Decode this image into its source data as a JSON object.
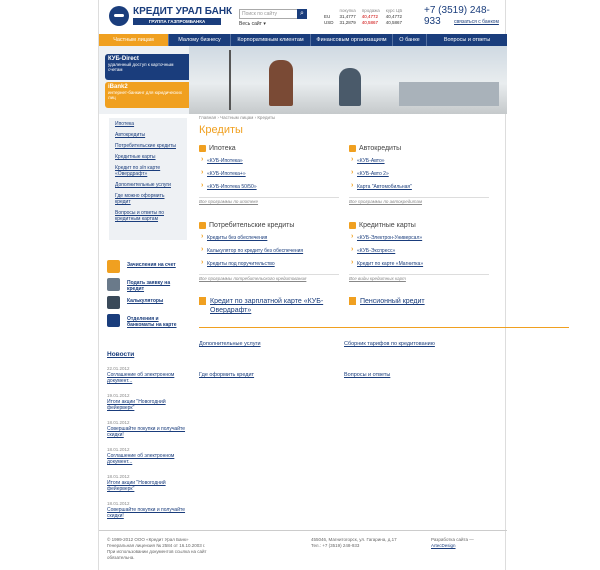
{
  "header": {
    "logo_name": "КРЕДИТ УРАЛ БАНК",
    "logo_sub": "ГРУППА ГАЗПРОМБАНКА",
    "search_placeholder": "Поиск по сайту",
    "all_site": "Весь сайт ▾",
    "rates": {
      "h1": "покупка",
      "h2": "продажа",
      "h3": "курс ЦБ",
      "eur": {
        "name": "EU",
        "buy": "31,4777",
        "sell": "40,4772",
        "cb": "40,4772"
      },
      "usd": {
        "name": "USD",
        "buy": "31,2879",
        "sell": "40,5867",
        "cb": "40,5867"
      }
    },
    "phone": "+7 (3519) 248-933",
    "contact": "связаться с банком"
  },
  "nav": [
    "Частным лицам",
    "Малому бизнесу",
    "Корпоративным клиентам",
    "Финансовым организациям",
    "О банке",
    "Вопросы и ответы"
  ],
  "banner": {
    "kub_title": "КУБ-Direct",
    "kub_text": "удаленный доступ к карточным счетам",
    "ibank_title": "iBank2",
    "ibank_text": "интернет-банкинг для юридических лиц"
  },
  "left_menu": [
    "Ипотека",
    "Автокредиты",
    "Потребительские кредиты",
    "Кредитные карты",
    "Кредит по з/п карте «Овердрафт»",
    "Дополнительные услуги",
    "Где можно оформить кредит",
    "Вопросы и ответы по кредитным картам"
  ],
  "services": [
    {
      "label": "Зачисления на счет",
      "color": "#f0a020"
    },
    {
      "label": "Подать заявку на кредит",
      "color": "#6a7a8a"
    },
    {
      "label": "Калькуляторы",
      "color": "#3a4a5a"
    },
    {
      "label": "Отделения и банкоматы на карте",
      "color": "#1a3d7c"
    }
  ],
  "news_title": "Новости",
  "news": [
    {
      "date": "22.01.2012",
      "text": "Соглашение об электронном документ..."
    },
    {
      "date": "19.01.2012",
      "text": "Итоги акции \"Новогодний фейерверк\""
    },
    {
      "date": "18.01.2012",
      "text": "Совершайте покупки и получайте скидки!"
    },
    {
      "date": "18.01.2012",
      "text": "Соглашение об электронном документ..."
    },
    {
      "date": "18.01.2012",
      "text": "Итоги акции \"Новогодний фейерверк\""
    },
    {
      "date": "18.01.2012",
      "text": "Совершайте покупки и получайте скидки!"
    }
  ],
  "main": {
    "breadcrumb": "Главная › Частным лицам › Кредиты",
    "title": "Кредиты",
    "ipoteka": {
      "title": "Ипотека",
      "items": [
        "«КУБ-Ипотека»",
        "«КУБ-Ипотека+»",
        "«КУБ-Ипотека 50/50»"
      ],
      "all": "Все программы по ипотеке"
    },
    "auto": {
      "title": "Автокредиты",
      "items": [
        "«КУБ-Авто»",
        "«КУБ-Авто 2»",
        "Карта \"Автомобильная\""
      ],
      "all": "Все программы по автокредитам"
    },
    "consumer": {
      "title": "Потребительские кредиты",
      "items": [
        "Кредиты без обеспечения",
        "Калькулятор по кредиту без обеспечения",
        "Кредиты под поручительство"
      ],
      "all": "Все программы потребительского кредитования"
    },
    "cards": {
      "title": "Кредитные карты",
      "items": [
        "«КУБ-Электрон-Универсал»",
        "«КУБ-Экспресс»",
        "Кредит по карте «Магнитка»"
      ],
      "all": "Все виды кредитных карт"
    },
    "salary": "Кредит по зарплатной карте «КУБ-Овердрафт»",
    "pension": "Пенсионный кредит",
    "links": [
      "Дополнительные услуги",
      "Сборник тарифов по кредитованию",
      "Где оформить кредит",
      "Вопросы и ответы"
    ]
  },
  "footer": {
    "copy1": "© 1999-2012 ООО «Кредит Урал Банк»",
    "copy2": "Генеральная лицензия № 2584 от 16.10.2003 г.",
    "copy3": "При использовании документов ссылка на сайт обязательна.",
    "addr1": "455046, Магнитогорск, ул. Гагарина, д.17",
    "addr2": "Тел.: +7 (3519) 248-933",
    "dev1": "Разработка сайта —",
    "dev2": "ArtecDesign"
  }
}
